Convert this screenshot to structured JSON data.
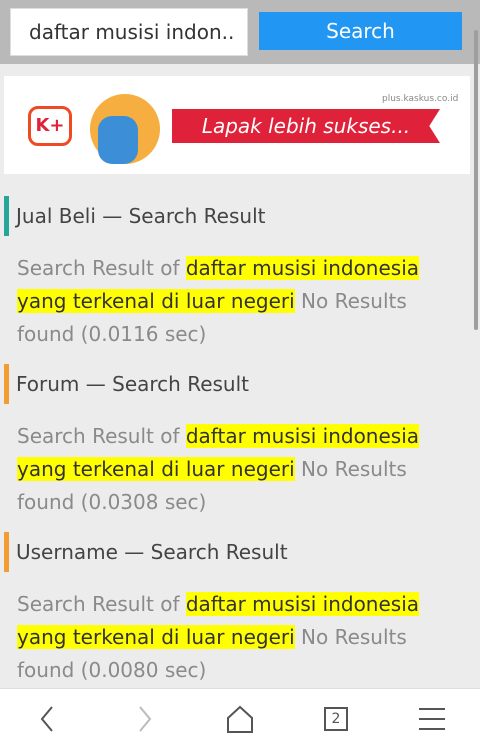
{
  "search": {
    "query": "daftar musisi indon..",
    "button_label": "Search"
  },
  "banner": {
    "tagline": "Lapak lebih sukses...",
    "site": "plus.kaskus.co.id",
    "logo_text": "K+"
  },
  "sections": [
    {
      "title": "Jual Beli — Search Result",
      "prefix": "Search Result of ",
      "query": "daftar musisi indonesia yang terkenal di luar negeri",
      "suffix": " No Results found (0.0116 sec)",
      "accent": "#26a69a"
    },
    {
      "title": "Forum — Search Result",
      "prefix": "Search Result of ",
      "query": "daftar musisi indonesia yang terkenal di luar negeri",
      "suffix": " No Results found (0.0308 sec)",
      "accent": "#f39c33"
    },
    {
      "title": "Username — Search Result",
      "prefix": "Search Result of ",
      "query": "daftar musisi indonesia yang terkenal di luar negeri",
      "suffix": "  No Results found (0.0080 sec)",
      "accent": "#f39c33"
    }
  ],
  "navbar": {
    "tab_count": "2",
    "icons": [
      "back-icon",
      "forward-icon",
      "home-icon",
      "tabs-icon",
      "menu-icon"
    ]
  },
  "colors": {
    "search_button": "#2196f3",
    "highlight": "#ffff00"
  }
}
